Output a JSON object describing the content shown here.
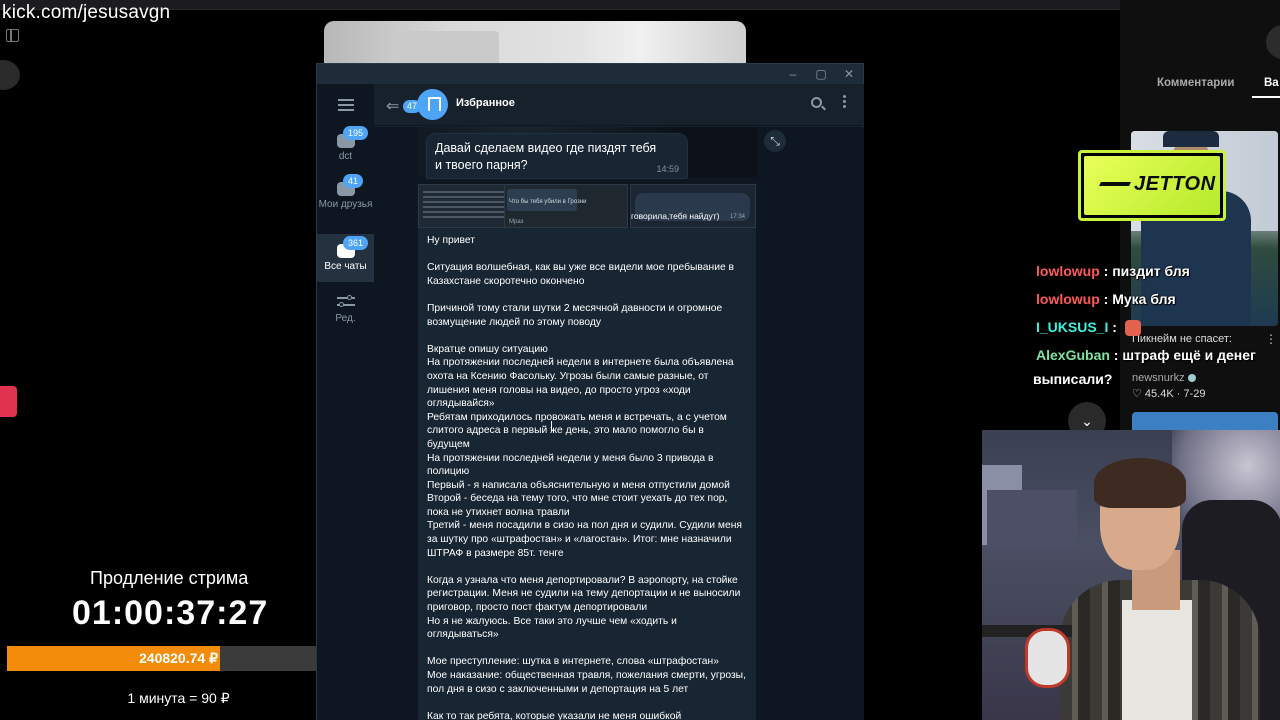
{
  "stream": {
    "url": "kick.com/jesusavgn"
  },
  "extension_widget": {
    "title": "Продление стрима",
    "timer": "01:00:37:27",
    "amount": "240820.74 ₽",
    "progress_fraction": 0.62,
    "rate": "1 минута = 90 ₽",
    "bar_color": "#f38c0b"
  },
  "telegram": {
    "folders": [
      {
        "label": "dct",
        "badge": "195",
        "icon": "folder-icon"
      },
      {
        "label": "Мои друзья",
        "badge": "41",
        "icon": "folder-icon"
      },
      {
        "label": "Все чаты",
        "badge": "361",
        "icon": "chats-icon"
      },
      {
        "label": "Ред.",
        "badge": "",
        "icon": "sliders-icon"
      }
    ],
    "header": {
      "unread": "47",
      "title": "Избранное"
    },
    "bubble": {
      "text": "Давай сделаем видео где пиздят тебя и твоего парня?",
      "time": "14:59"
    },
    "thumb": {
      "q_text": "Что бы тебя убили в Грозни",
      "sender": "Мраз",
      "strip_text": "говорила,тебя найдут)",
      "strip_time": "17:34"
    },
    "long_message": [
      "Ну привет",
      "",
      "Ситуация волшебная, как вы уже все видели мое пребывание в Казахстане скоротечно окончено",
      "",
      "Причиной тому стали шутки 2 месячной давности и огромное возмущение людей по этому поводу",
      "",
      "Вкратце опишу ситуацию",
      "На протяжении последней недели в интернете была объявлена охота на Ксению Фасольку. Угрозы были самые разные, от лишения меня головы на видео, до просто угроз «ходи оглядывайся»",
      "Ребятам приходилось провожать меня и встречать, а с учетом слитого адреса в первый же день, это мало помогло бы в будущем",
      "На протяжении последней недели у меня было 3 привода в полицию",
      "Первый - я написала объяснительную и меня отпустили домой",
      "Второй - беседа на тему того, что мне стоит уехать до тех пор, пока не утихнет волна травли",
      "Третий - меня посадили в сизо на пол дня и судили. Судили меня за шутку про «штрафостан» и «лагостан». Итог: мне назначили ШТРАФ в размере 85т. тенге",
      "",
      "Когда я узнала что меня депортировали? В аэропорту, на стойке регистрации. Меня не судили на тему депортации и не выносили приговор, просто пост фактум депортировали",
      "Но я не жалуюсь. Все таки это лучше чем «ходить и оглядываться»",
      "",
      "Мое преступление: шутка в интернете, слова «штрафостан»",
      "Мое наказание: общественная травля, пожелания смерти, угрозы, пол дня в сизо с заключенными и депортация на 5 лет",
      "",
      "Как то так ребята, которые указали не меня ошибкой"
    ]
  },
  "right_panel": {
    "tabs": [
      "Комментарии",
      "Ва"
    ],
    "ad_logo": "JETTON",
    "video_title_fragment": "Пикнейм не спасет:",
    "channel": "newsnurkz",
    "stats": "♡ 45.4K · 7-29"
  },
  "stream_chat": [
    {
      "user": "lowlowup",
      "user_color": "#ff5a5a",
      "text": "пиздит бля"
    },
    {
      "user": "lowlowup",
      "user_color": "#ff5a5a",
      "text": "Мука бля"
    },
    {
      "user": "I_UKSUS_I",
      "user_color": "#3ff0e0",
      "text": ""
    },
    {
      "user": "AlexGuban",
      "user_color": "#7de3a0",
      "text": "штраф ещё и денег"
    },
    {
      "user": "",
      "user_color": "#ffffff",
      "text": "выписали?"
    }
  ]
}
